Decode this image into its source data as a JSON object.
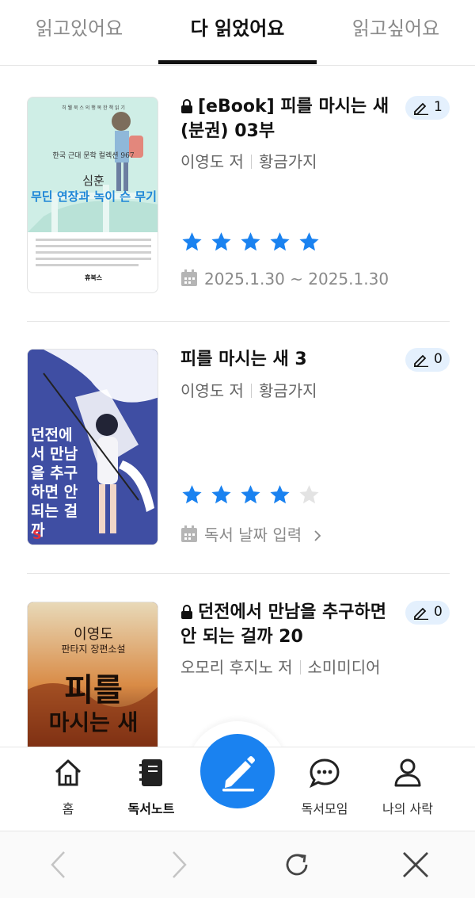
{
  "tabs": [
    {
      "label": "읽고있어요"
    },
    {
      "label": "다 읽었어요"
    },
    {
      "label": "읽고싶어요"
    }
  ],
  "books": [
    {
      "title": "[eBook] 피를 마시는 새 (분권) 03부",
      "locked": true,
      "author": "이영도 저",
      "publisher": "황금가지",
      "note_count": "1",
      "rating": 5,
      "date": "2025.1.30 ~ 2025.1.30",
      "cover": {
        "top_text": "히 웰 북 스 의 행 복 한 책 읽 기",
        "series": "한국 근대 문학 컬렉션 967",
        "author": "심훈",
        "title": "무딘 연장과 녹이 슨 무기",
        "logo": "휴북스"
      }
    },
    {
      "title": "피를 마시는 새 3",
      "locked": false,
      "author": "이영도 저",
      "publisher": "황금가지",
      "note_count": "0",
      "rating": 4,
      "date_prompt": "독서 날짜 입력",
      "cover": {
        "title": "던전에서 만남을 추구하면 안 되는 걸까",
        "badge": "S"
      }
    },
    {
      "title": "던전에서 만남을 추구하면 안 되는 걸까 20",
      "locked": true,
      "author": "오모리 후지노 저",
      "publisher": "소미미디어",
      "note_count": "0",
      "cover": {
        "author": "이영도",
        "subtitle": "판타지 장편소설",
        "title_line1": "피를",
        "title_line2": "마시는 새"
      }
    }
  ],
  "nav": [
    {
      "label": "홈",
      "icon": "home-icon"
    },
    {
      "label": "독서노트",
      "icon": "notebook-icon"
    },
    {
      "label": "독서모임",
      "icon": "chat-bubble-icon"
    },
    {
      "label": "나의 사락",
      "icon": "person-icon"
    }
  ],
  "fab": {
    "icon": "pen-icon"
  },
  "browser": {
    "icons": [
      "back-icon",
      "forward-icon",
      "refresh-icon",
      "close-icon"
    ]
  },
  "colors": {
    "accent": "#1a82f0",
    "star_on": "#1a82f0",
    "star_off": "#e3e3e3",
    "badge_bg": "#e4f0fd"
  }
}
